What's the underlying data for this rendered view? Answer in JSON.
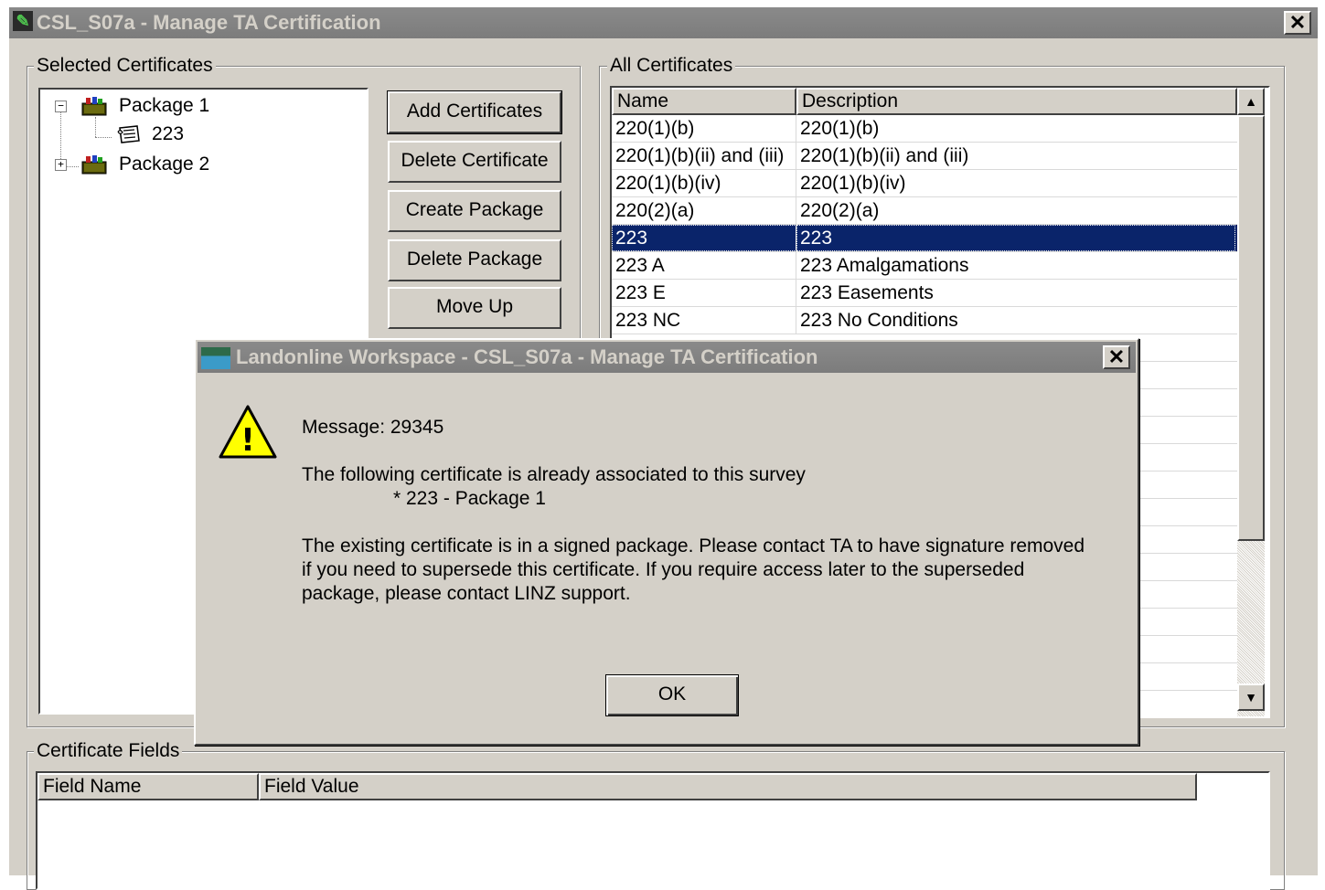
{
  "window": {
    "title": "CSL_S07a - Manage TA Certification",
    "close_glyph": "✕"
  },
  "selected": {
    "group_label": "Selected Certificates",
    "tree": [
      {
        "label": "Package 1",
        "expander": "−"
      },
      {
        "label": "223"
      },
      {
        "label": "Package 2",
        "expander": "+"
      }
    ]
  },
  "buttons": {
    "add_certificates": "Add Certificates",
    "delete_certificate": "Delete Certificate",
    "create_package": "Create Package",
    "delete_package": "Delete Package",
    "move_up": "Move Up"
  },
  "all": {
    "group_label": "All Certificates",
    "columns": [
      "Name",
      "Description"
    ],
    "rows": [
      {
        "name": "220(1)(b)",
        "description": "220(1)(b)"
      },
      {
        "name": "220(1)(b)(ii) and (iii)",
        "description": "220(1)(b)(ii) and (iii)"
      },
      {
        "name": "220(1)(b)(iv)",
        "description": "220(1)(b)(iv)"
      },
      {
        "name": "220(2)(a)",
        "description": "220(2)(a)"
      },
      {
        "name": "223",
        "description": "223",
        "selected": true
      },
      {
        "name": "223 A",
        "description": "223 Amalgamations"
      },
      {
        "name": "223 E",
        "description": "223 Easements"
      },
      {
        "name": "223 NC",
        "description": "223 No Conditions"
      }
    ],
    "scroll_up": "▲",
    "scroll_down": "▼"
  },
  "fields": {
    "group_label": "Certificate Fields",
    "columns": [
      "Field Name",
      "Field Value"
    ]
  },
  "dialog": {
    "title": "Landonline Workspace - CSL_S07a - Manage TA Certification",
    "close_glyph": "✕",
    "warning_glyph": "!",
    "message_id": "Message: 29345",
    "line1": "The following certificate is already associated to this survey",
    "line2": "* 223 - Package 1",
    "para_lines": [
      "The existing certificate is in a signed package. Please contact TA to have signature removed",
      "if you need to supersede this certificate. If you require access later to the superseded",
      "package, please contact LINZ support."
    ],
    "ok_label": "OK"
  }
}
